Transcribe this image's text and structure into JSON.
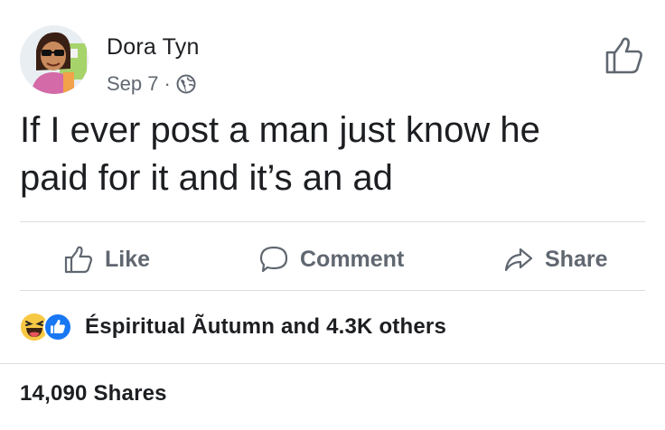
{
  "post": {
    "author": "Dora Tyn",
    "date": "Sep 7",
    "separator": "·",
    "privacy_icon": "globe-icon",
    "text": "If I ever post a man just know he\npaid for it and it’s an ad"
  },
  "actions": {
    "like_label": "Like",
    "comment_label": "Comment",
    "share_label": "Share"
  },
  "reactions": {
    "icons": [
      "haha-icon",
      "like-reaction-icon"
    ],
    "summary": "Éspiritual Ãutumn and 4.3K others"
  },
  "shares": {
    "count_text": "14,090 Shares"
  },
  "colors": {
    "text": "#1c1e21",
    "muted": "#606770",
    "like_blue": "#1877f2",
    "haha_yellow": "#f7c843",
    "divider": "#dadde1"
  }
}
